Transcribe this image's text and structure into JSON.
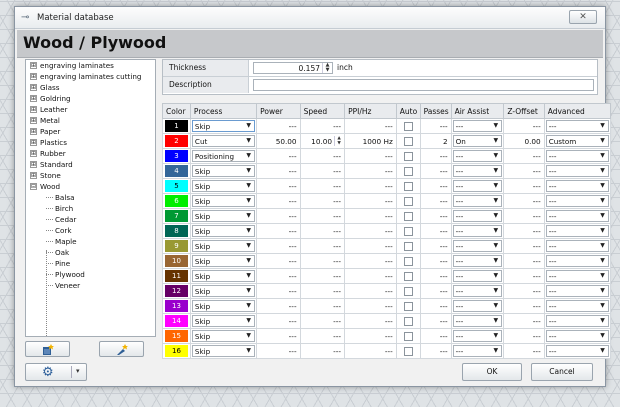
{
  "window": {
    "title": "Material database",
    "close_label": "✕"
  },
  "header": {
    "title": "Wood / Plywood"
  },
  "tree": {
    "top_items": [
      {
        "label": "engraving laminates",
        "expander": "⊞"
      },
      {
        "label": "engraving laminates cutting",
        "expander": "⊞"
      },
      {
        "label": "Glass",
        "expander": "⊞"
      },
      {
        "label": "Goldring",
        "expander": "⊞"
      },
      {
        "label": "Leather",
        "expander": "⊞"
      },
      {
        "label": "Metal",
        "expander": "⊞"
      },
      {
        "label": "Paper",
        "expander": "⊞"
      },
      {
        "label": "Plastics",
        "expander": "⊞"
      },
      {
        "label": "Rubber",
        "expander": "⊞"
      },
      {
        "label": "Standard",
        "expander": "⊞"
      },
      {
        "label": "Stone",
        "expander": "⊞"
      },
      {
        "label": "Wood",
        "expander": "⊟"
      }
    ],
    "wood_children": [
      "Balsa",
      "Birch",
      "Cedar",
      "Cork",
      "Maple",
      "Oak",
      "Pine",
      "Plywood",
      "Veneer"
    ]
  },
  "props": {
    "thickness_label": "Thickness",
    "thickness_value": "0.157",
    "thickness_unit": "inch",
    "description_label": "Description",
    "description_value": ""
  },
  "grid": {
    "headers": [
      "Color",
      "Process",
      "Power",
      "Speed",
      "PPI/Hz",
      "Auto",
      "Passes",
      "Air Assist",
      "Z-Offset",
      "Advanced"
    ],
    "rows": [
      {
        "num": "1",
        "bg": "#000000",
        "fg": "#ffffff",
        "process": "Skip",
        "power": "---",
        "speed": "---",
        "ppi": "---",
        "passes": "---",
        "air": "---",
        "z": "---",
        "adv": "---",
        "selected": true
      },
      {
        "num": "2",
        "bg": "#ff0000",
        "fg": "#ffffff",
        "process": "Cut",
        "power": "50.00",
        "speed": "10.00",
        "ppi": "1000 Hz",
        "passes": "2",
        "air": "On",
        "z": "0.00",
        "adv": "Custom"
      },
      {
        "num": "3",
        "bg": "#0000ff",
        "fg": "#ffffff",
        "process": "Positioning",
        "power": "---",
        "speed": "---",
        "ppi": "---",
        "passes": "---",
        "air": "---",
        "z": "---",
        "adv": "---"
      },
      {
        "num": "4",
        "bg": "#336699",
        "fg": "#ffffff",
        "process": "Skip",
        "power": "---",
        "speed": "---",
        "ppi": "---",
        "passes": "---",
        "air": "---",
        "z": "---",
        "adv": "---"
      },
      {
        "num": "5",
        "bg": "#00ffff",
        "fg": "#000000",
        "process": "Skip",
        "power": "---",
        "speed": "---",
        "ppi": "---",
        "passes": "---",
        "air": "---",
        "z": "---",
        "adv": "---"
      },
      {
        "num": "6",
        "bg": "#00ee00",
        "fg": "#ffffff",
        "process": "Skip",
        "power": "---",
        "speed": "---",
        "ppi": "---",
        "passes": "---",
        "air": "---",
        "z": "---",
        "adv": "---"
      },
      {
        "num": "7",
        "bg": "#009933",
        "fg": "#ffffff",
        "process": "Skip",
        "power": "---",
        "speed": "---",
        "ppi": "---",
        "passes": "---",
        "air": "---",
        "z": "---",
        "adv": "---"
      },
      {
        "num": "8",
        "bg": "#006655",
        "fg": "#ffffff",
        "process": "Skip",
        "power": "---",
        "speed": "---",
        "ppi": "---",
        "passes": "---",
        "air": "---",
        "z": "---",
        "adv": "---"
      },
      {
        "num": "9",
        "bg": "#999933",
        "fg": "#ffffff",
        "process": "Skip",
        "power": "---",
        "speed": "---",
        "ppi": "---",
        "passes": "---",
        "air": "---",
        "z": "---",
        "adv": "---"
      },
      {
        "num": "10",
        "bg": "#996633",
        "fg": "#ffffff",
        "process": "Skip",
        "power": "---",
        "speed": "---",
        "ppi": "---",
        "passes": "---",
        "air": "---",
        "z": "---",
        "adv": "---"
      },
      {
        "num": "11",
        "bg": "#663300",
        "fg": "#ffffff",
        "process": "Skip",
        "power": "---",
        "speed": "---",
        "ppi": "---",
        "passes": "---",
        "air": "---",
        "z": "---",
        "adv": "---"
      },
      {
        "num": "12",
        "bg": "#660066",
        "fg": "#ffffff",
        "process": "Skip",
        "power": "---",
        "speed": "---",
        "ppi": "---",
        "passes": "---",
        "air": "---",
        "z": "---",
        "adv": "---"
      },
      {
        "num": "13",
        "bg": "#9900cc",
        "fg": "#ffffff",
        "process": "Skip",
        "power": "---",
        "speed": "---",
        "ppi": "---",
        "passes": "---",
        "air": "---",
        "z": "---",
        "adv": "---"
      },
      {
        "num": "14",
        "bg": "#ff00ff",
        "fg": "#ffffff",
        "process": "Skip",
        "power": "---",
        "speed": "---",
        "ppi": "---",
        "passes": "---",
        "air": "---",
        "z": "---",
        "adv": "---"
      },
      {
        "num": "15",
        "bg": "#ff6600",
        "fg": "#ffffff",
        "process": "Skip",
        "power": "---",
        "speed": "---",
        "ppi": "---",
        "passes": "---",
        "air": "---",
        "z": "---",
        "adv": "---"
      },
      {
        "num": "16",
        "bg": "#ffff00",
        "fg": "#000000",
        "process": "Skip",
        "power": "---",
        "speed": "---",
        "ppi": "---",
        "passes": "---",
        "air": "---",
        "z": "---",
        "adv": "---"
      }
    ]
  },
  "buttons": {
    "ok": "OK",
    "cancel": "Cancel",
    "gear_icon": "⚙",
    "gear_caret": "▾",
    "new_icon": "new-material-icon",
    "edit_icon": "edit-material-icon"
  }
}
